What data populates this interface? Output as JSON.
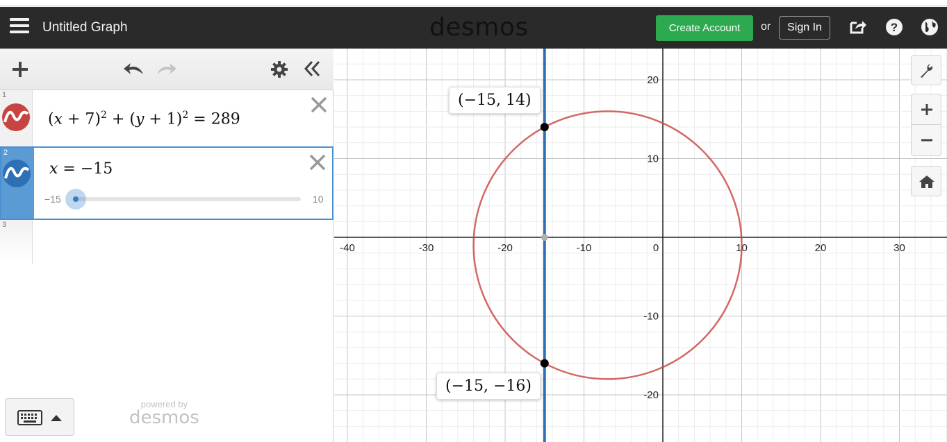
{
  "header": {
    "title": "Untitled Graph",
    "logo": "desmos",
    "create_account": "Create Account",
    "or": "or",
    "sign_in": "Sign In"
  },
  "toolbar": {
    "icons": [
      "plus-icon",
      "undo-icon",
      "redo-icon",
      "gear-icon",
      "collapse-icon"
    ]
  },
  "expressions": [
    {
      "index": "1",
      "latex_text": "(x + 7)² + (y + 1)² = 289",
      "color": "#c74440"
    },
    {
      "index": "2",
      "latex_text": "x = −15",
      "color": "#2d70b3",
      "slider": {
        "min": "−15",
        "max": "10",
        "value": -15
      }
    },
    {
      "index": "3"
    }
  ],
  "footer": {
    "powered_by": "powered by",
    "brand": "desmos"
  },
  "graph": {
    "x_ticks": [
      "-40",
      "-30",
      "-20",
      "-10",
      "0",
      "10",
      "20",
      "30"
    ],
    "y_ticks": [
      "20",
      "10",
      "-10",
      "-20"
    ],
    "points": [
      {
        "label": "(−15, 14)",
        "x": -15,
        "y": 14
      },
      {
        "label": "(−15, −16)",
        "x": -15,
        "y": -16
      }
    ],
    "circle": {
      "h": -7,
      "k": -1,
      "r": 17,
      "color": "#c74440"
    },
    "line": {
      "x": -15,
      "color": "#2d70b3"
    }
  },
  "zoom_controls": [
    "wrench-icon",
    "zoom-in-icon",
    "zoom-out-icon",
    "home-icon"
  ]
}
